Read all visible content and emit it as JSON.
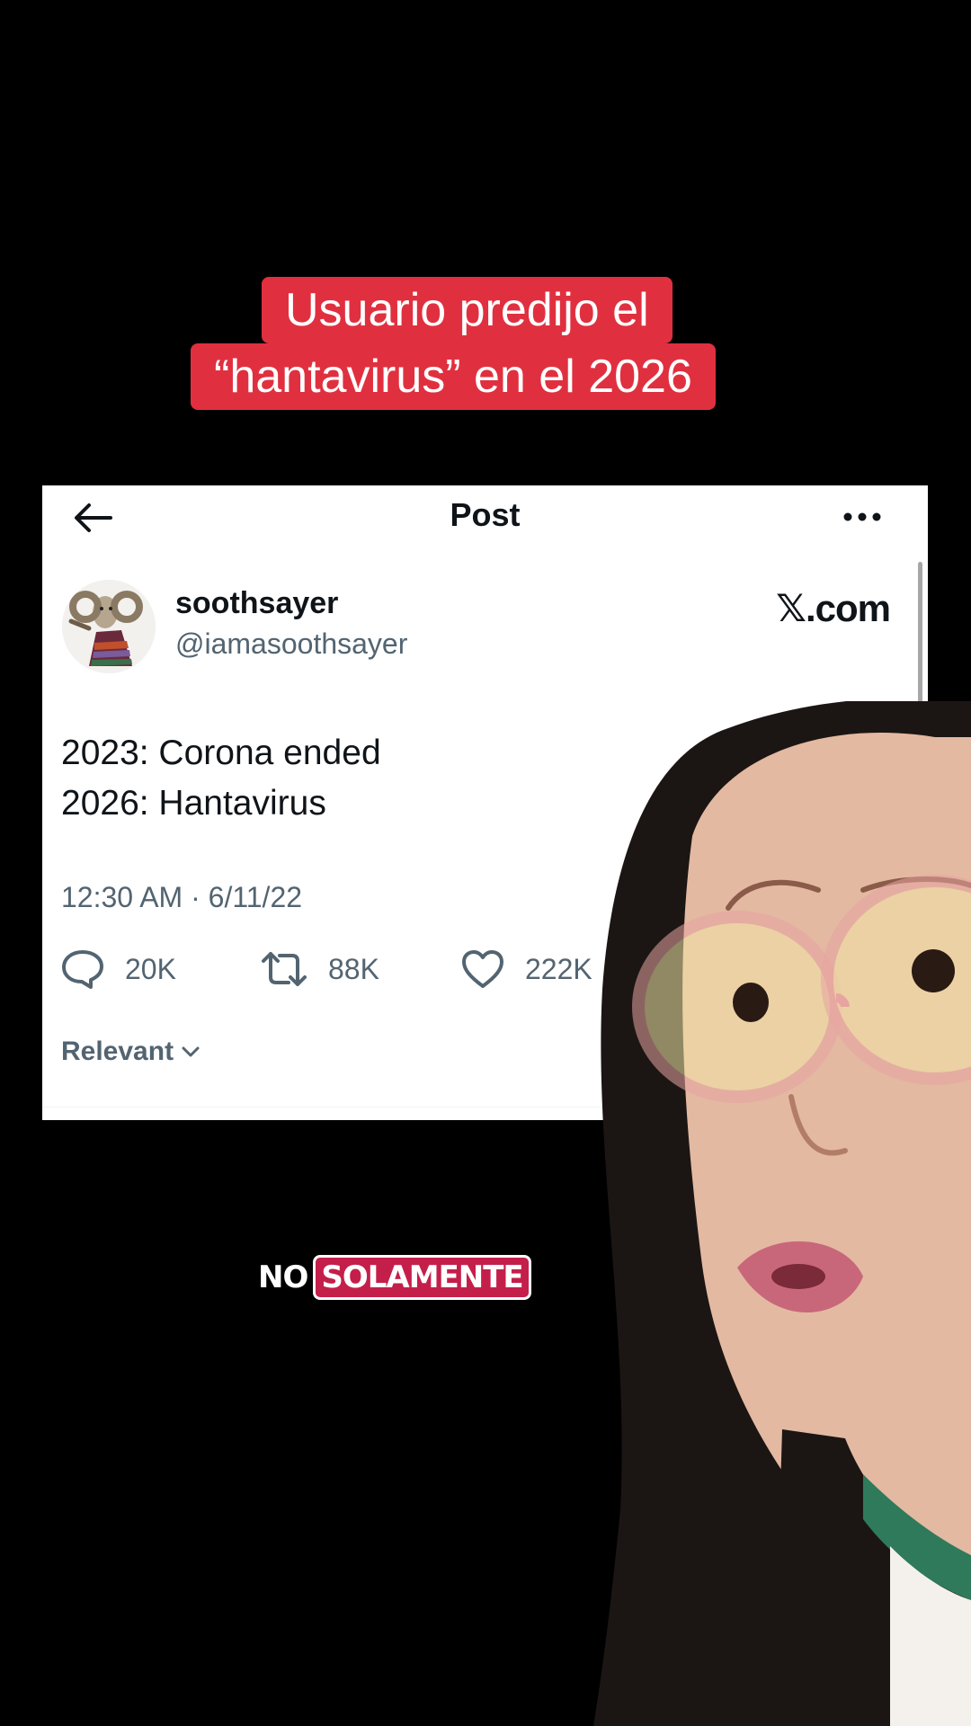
{
  "headline": {
    "line1": "Usuario predijo el",
    "line2": "“hantavirus” en el 2026"
  },
  "post": {
    "nav_title": "Post",
    "author_name": "soothsayer",
    "author_handle": "@iamasoothsayer",
    "watermark_suffix": ".com",
    "text_lines": [
      "2023: Corona ended",
      "2026: Hantavirus"
    ],
    "timestamp": "12:30 AM · 6/11/22",
    "stats": {
      "replies": "20K",
      "reposts": "88K",
      "likes": "222K"
    },
    "sort_label": "Relevant"
  },
  "subtitle": {
    "word1": "NO",
    "word2": "SOLAMENTE"
  },
  "colors": {
    "headline_bg": "#e0303f",
    "subtitle_highlight": "#c41f4a",
    "text_primary": "#0f1419",
    "text_secondary": "#536471"
  }
}
